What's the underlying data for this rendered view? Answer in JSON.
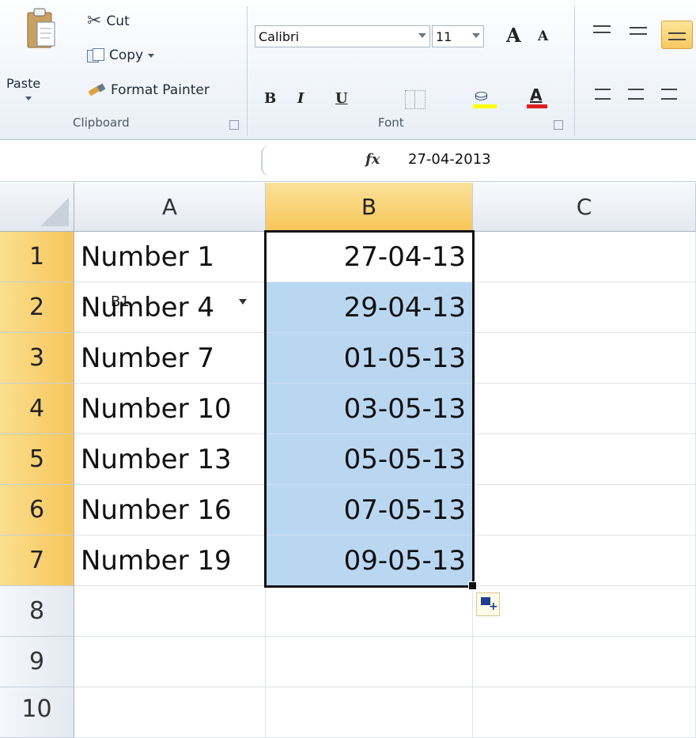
{
  "ribbon": {
    "clipboard": {
      "paste_label": "Paste",
      "cut_label": "Cut",
      "copy_label": "Copy",
      "format_painter_label": "Format Painter",
      "group_label": "Clipboard"
    },
    "font": {
      "font_name": "Calibri",
      "font_size": "11",
      "bold": "B",
      "italic": "I",
      "underline": "U",
      "font_color_glyph": "A",
      "grow_glyph": "A",
      "shrink_glyph": "A",
      "group_label": "Font"
    }
  },
  "formula_bar": {
    "name_box": "B1",
    "fx_label": "fx",
    "formula": "27-04-2013"
  },
  "sheet": {
    "columns": [
      "A",
      "B",
      "C"
    ],
    "rows": [
      {
        "num": "1",
        "a": "Number 1",
        "b": "27-04-13"
      },
      {
        "num": "2",
        "a": "Number 4",
        "b": "29-04-13"
      },
      {
        "num": "3",
        "a": "Number 7",
        "b": "01-05-13"
      },
      {
        "num": "4",
        "a": "Number 10",
        "b": "03-05-13"
      },
      {
        "num": "5",
        "a": "Number 13",
        "b": "05-05-13"
      },
      {
        "num": "6",
        "a": "Number 16",
        "b": "07-05-13"
      },
      {
        "num": "7",
        "a": "Number 19",
        "b": "09-05-13"
      },
      {
        "num": "8",
        "a": "",
        "b": ""
      },
      {
        "num": "9",
        "a": "",
        "b": ""
      },
      {
        "num": "10",
        "a": "",
        "b": ""
      }
    ]
  },
  "colors": {
    "selection_fill": "#bad7f2",
    "header_selected": "#f7c659",
    "font_color_bar": "#e02020",
    "highlight_bar": "#ffff00"
  }
}
